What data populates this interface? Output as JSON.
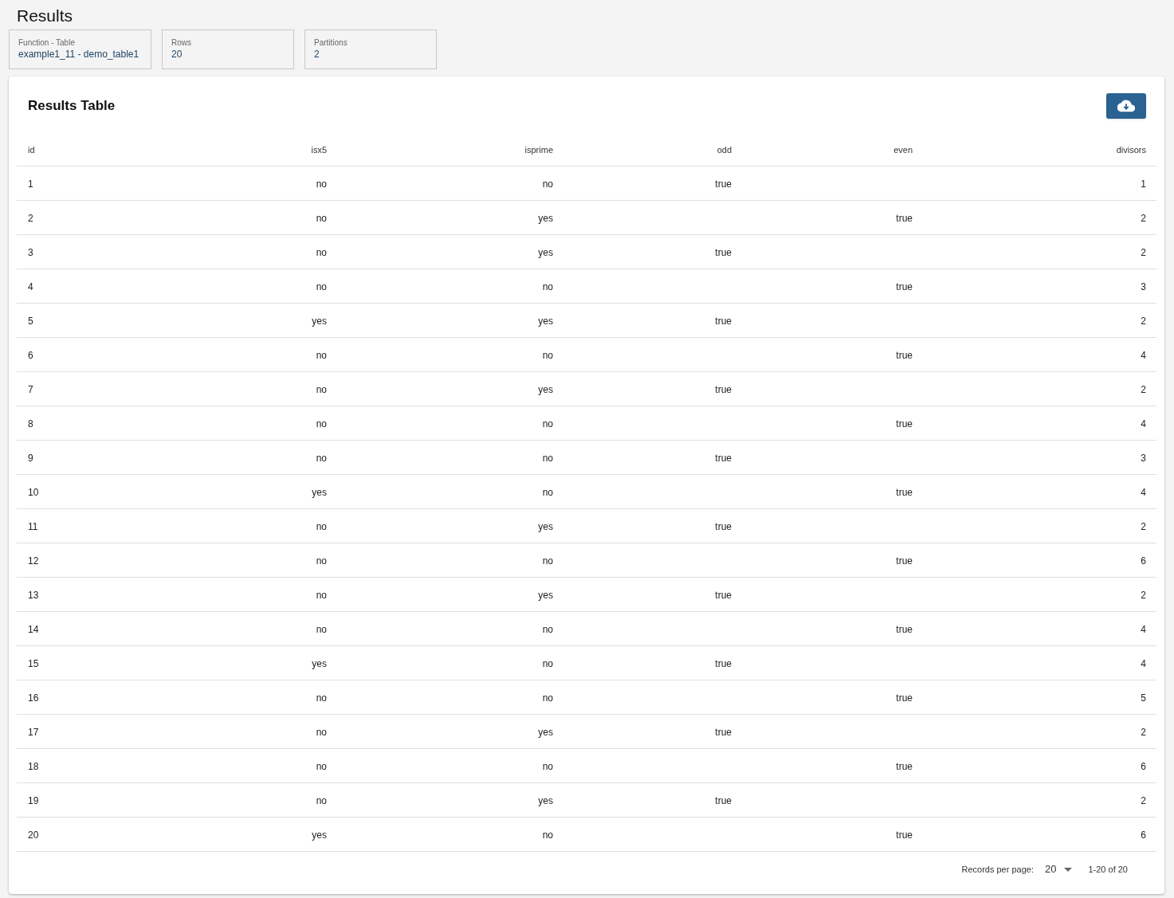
{
  "page_title": "Results",
  "info_cards": [
    {
      "label": "Function - Table",
      "value": "example1_11 - demo_table1"
    },
    {
      "label": "Rows",
      "value": "20"
    },
    {
      "label": "Partitions",
      "value": "2"
    }
  ],
  "results_table": {
    "title": "Results Table",
    "columns": [
      "id",
      "isx5",
      "isprime",
      "odd",
      "even",
      "divisors"
    ],
    "rows": [
      [
        "1",
        "no",
        "no",
        "true",
        null,
        "1"
      ],
      [
        "2",
        "no",
        "yes",
        null,
        "true",
        "2"
      ],
      [
        "3",
        "no",
        "yes",
        "true",
        null,
        "2"
      ],
      [
        "4",
        "no",
        "no",
        null,
        "true",
        "3"
      ],
      [
        "5",
        "yes",
        "yes",
        "true",
        null,
        "2"
      ],
      [
        "6",
        "no",
        "no",
        null,
        "true",
        "4"
      ],
      [
        "7",
        "no",
        "yes",
        "true",
        null,
        "2"
      ],
      [
        "8",
        "no",
        "no",
        null,
        "true",
        "4"
      ],
      [
        "9",
        "no",
        "no",
        "true",
        null,
        "3"
      ],
      [
        "10",
        "yes",
        "no",
        null,
        "true",
        "4"
      ],
      [
        "11",
        "no",
        "yes",
        "true",
        null,
        "2"
      ],
      [
        "12",
        "no",
        "no",
        null,
        "true",
        "6"
      ],
      [
        "13",
        "no",
        "yes",
        "true",
        null,
        "2"
      ],
      [
        "14",
        "no",
        "no",
        null,
        "true",
        "4"
      ],
      [
        "15",
        "yes",
        "no",
        "true",
        null,
        "4"
      ],
      [
        "16",
        "no",
        "no",
        null,
        "true",
        "5"
      ],
      [
        "17",
        "no",
        "yes",
        "true",
        null,
        "2"
      ],
      [
        "18",
        "no",
        "no",
        null,
        "true",
        "6"
      ],
      [
        "19",
        "no",
        "yes",
        "true",
        null,
        "2"
      ],
      [
        "20",
        "yes",
        "no",
        null,
        "true",
        "6"
      ]
    ],
    "pagination": {
      "records_label": "Records per page:",
      "per_page": "20",
      "range": "1-20 of 20"
    }
  }
}
